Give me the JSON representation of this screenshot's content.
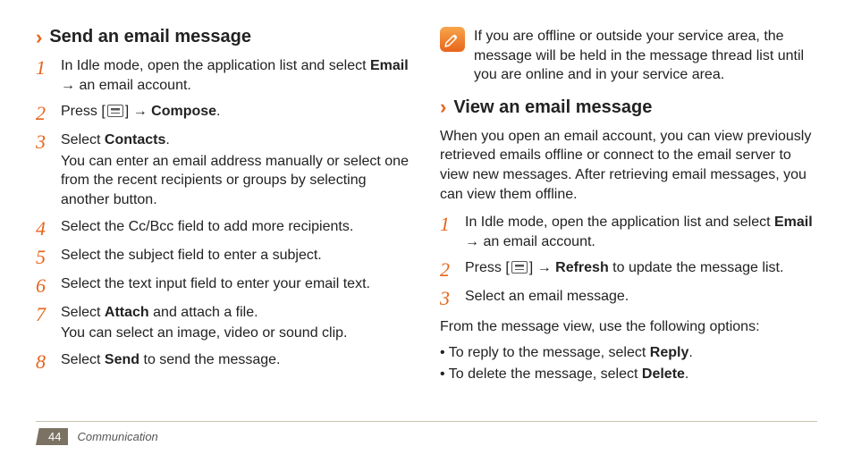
{
  "left": {
    "heading": "Send an email message",
    "steps": [
      {
        "num": "1",
        "pre": "In Idle mode, open the application list and select ",
        "bold": "Email",
        "post": " → an email account."
      },
      {
        "num": "2",
        "pre": "Press [",
        "icon": true,
        "mid": "] → ",
        "bold": "Compose",
        "post": "."
      },
      {
        "num": "3",
        "pre": "Select ",
        "bold": "Contacts",
        "post": ".",
        "sub": "You can enter an email address manually or select one from the recent recipients or groups by selecting another button."
      },
      {
        "num": "4",
        "pre": "Select the Cc/Bcc field to add more recipients."
      },
      {
        "num": "5",
        "pre": "Select the subject field to enter a subject."
      },
      {
        "num": "6",
        "pre": "Select the text input field to enter your email text."
      },
      {
        "num": "7",
        "pre": "Select ",
        "bold": "Attach",
        "post": " and attach a file.",
        "sub": "You can select an image, video or sound clip."
      },
      {
        "num": "8",
        "pre": "Select ",
        "bold": "Send",
        "post": " to send the message."
      }
    ]
  },
  "right": {
    "note": "If you are offline or outside your service area, the message will be held in the message thread list until you are online and in your service area.",
    "heading": "View an email message",
    "intro": "When you open an email account, you can view previously retrieved emails offline or connect to the email server to view new messages. After retrieving email messages, you can view them offline.",
    "steps": [
      {
        "num": "1",
        "pre": "In Idle mode, open the application list and select ",
        "bold": "Email",
        "post": " → an email account."
      },
      {
        "num": "2",
        "pre": "Press [",
        "icon": true,
        "mid": "] → ",
        "bold": "Refresh",
        "post": " to update the message list."
      },
      {
        "num": "3",
        "pre": "Select an email message."
      }
    ],
    "options_intro": "From the message view, use the following options:",
    "bullets": [
      {
        "pre": "To reply to the message, select ",
        "bold": "Reply",
        "post": "."
      },
      {
        "pre": "To delete the message, select ",
        "bold": "Delete",
        "post": "."
      }
    ]
  },
  "footer": {
    "page": "44",
    "section": "Communication"
  }
}
